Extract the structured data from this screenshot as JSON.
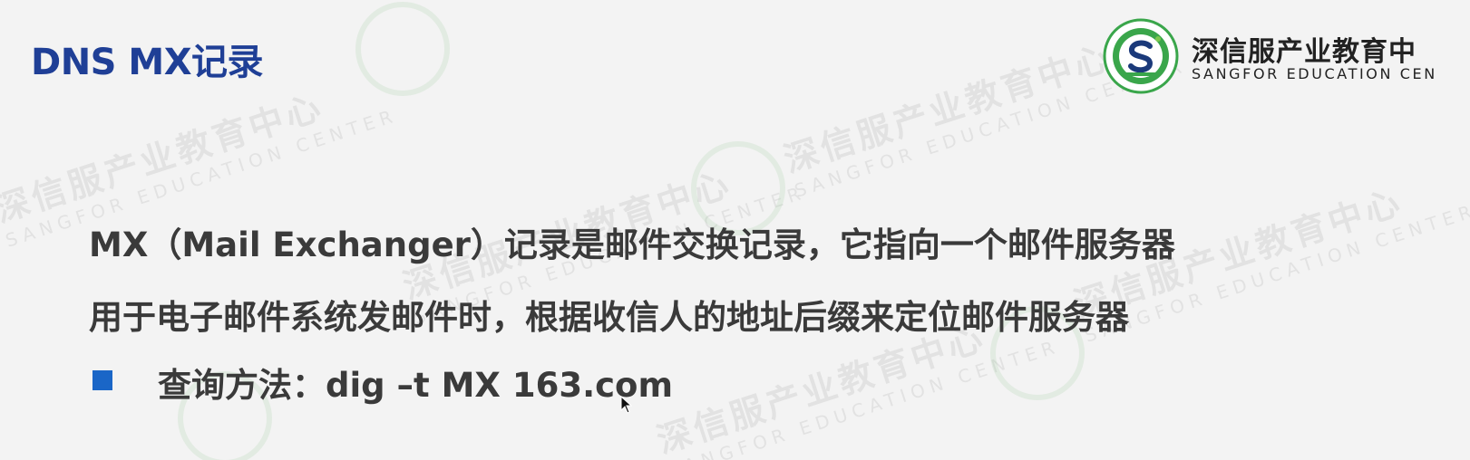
{
  "slide": {
    "title": "DNS MX记录",
    "lines": [
      "MX（Mail Exchanger）记录是邮件交换记录，它指向一个邮件服务器",
      "用于电子邮件系统发邮件时，根据收信人的地址后缀来定位邮件服务器"
    ],
    "bullet": "查询方法：dig –t MX 163.com"
  },
  "logo": {
    "name_cn": "深信服产业教育中",
    "name_en": "SANGFOR EDUCATION CEN",
    "seal_text": "SANGFOR EDUCATION CENTER"
  },
  "watermark": {
    "text_cn": "深信服产业教育中心",
    "text_en": "SANGFOR EDUCATION CENTER"
  },
  "colors": {
    "title": "#1f3f96",
    "body_text": "#3a3a3a",
    "bullet": "#1a66c7",
    "logo_green": "#3aa64b",
    "logo_navy": "#1b3a7a"
  },
  "icons": {
    "logo": "sangfor-seal-icon",
    "bullet": "square-bullet-icon",
    "cursor": "mouse-cursor-icon"
  }
}
